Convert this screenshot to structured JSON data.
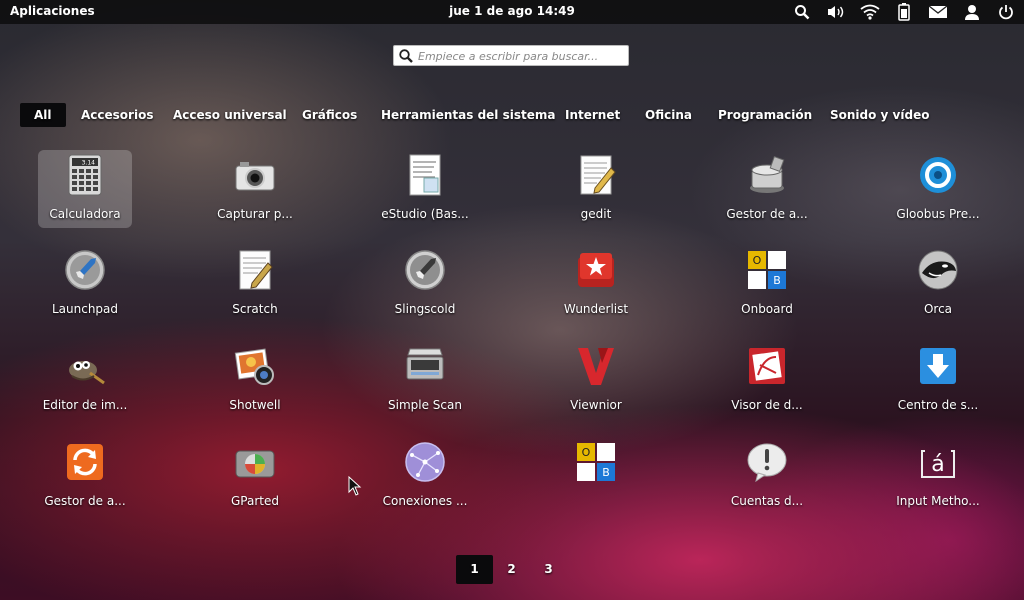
{
  "topbar": {
    "apps_label": "Aplicaciones",
    "clock": "jue  1 de ago 14:49",
    "tray": [
      "search-icon",
      "volume-icon",
      "wifi-icon",
      "battery-icon",
      "mail-icon",
      "user-icon",
      "power-icon"
    ]
  },
  "search": {
    "placeholder": "Empiece a escribir para buscar..."
  },
  "categories": [
    "All",
    "Accesorios",
    "Acceso universal",
    "Gráficos",
    "Herramientas del sistema",
    "Internet",
    "Oficina",
    "Programación",
    "Sonido y vídeo"
  ],
  "apps": [
    {
      "label": "Calculadora",
      "icon": "calculator-icon"
    },
    {
      "label": "Capturar p...",
      "icon": "camera-icon"
    },
    {
      "label": "eStudio (Bas...",
      "icon": "code-document-icon"
    },
    {
      "label": "gedit",
      "icon": "text-editor-icon"
    },
    {
      "label": "Gestor de a...",
      "icon": "archive-manager-icon"
    },
    {
      "label": "Gloobus Pre...",
      "icon": "gloobus-icon"
    },
    {
      "label": "Launchpad",
      "icon": "rocket-icon"
    },
    {
      "label": "Scratch",
      "icon": "scratch-editor-icon"
    },
    {
      "label": "Slingscold",
      "icon": "slingscold-rocket-icon"
    },
    {
      "label": "Wunderlist",
      "icon": "wunderlist-icon"
    },
    {
      "label": "Onboard",
      "icon": "onboard-keyboard-icon"
    },
    {
      "label": "Orca",
      "icon": "orca-icon"
    },
    {
      "label": "Editor de im...",
      "icon": "gimp-icon"
    },
    {
      "label": "Shotwell",
      "icon": "shotwell-icon"
    },
    {
      "label": "Simple Scan",
      "icon": "scanner-icon"
    },
    {
      "label": "Viewnior",
      "icon": "viewnior-icon"
    },
    {
      "label": "Visor de d...",
      "icon": "document-viewer-icon"
    },
    {
      "label": "Centro de s...",
      "icon": "software-center-icon"
    },
    {
      "label": "Gestor de a...",
      "icon": "update-manager-icon"
    },
    {
      "label": "GParted",
      "icon": "gparted-icon"
    },
    {
      "label": "Conexiones ...",
      "icon": "network-connections-icon"
    },
    {
      "label": "",
      "icon": "onboard-keyboard-icon"
    },
    {
      "label": "Cuentas d...",
      "icon": "accounts-icon"
    },
    {
      "label": "Input Metho...",
      "icon": "input-method-icon"
    }
  ],
  "pages": [
    "1",
    "2",
    "3"
  ],
  "colors": {
    "bar_bg": "#0e0e10",
    "active_tab_bg": "#0a0a0c",
    "selected_tile": "#ffffff38"
  }
}
